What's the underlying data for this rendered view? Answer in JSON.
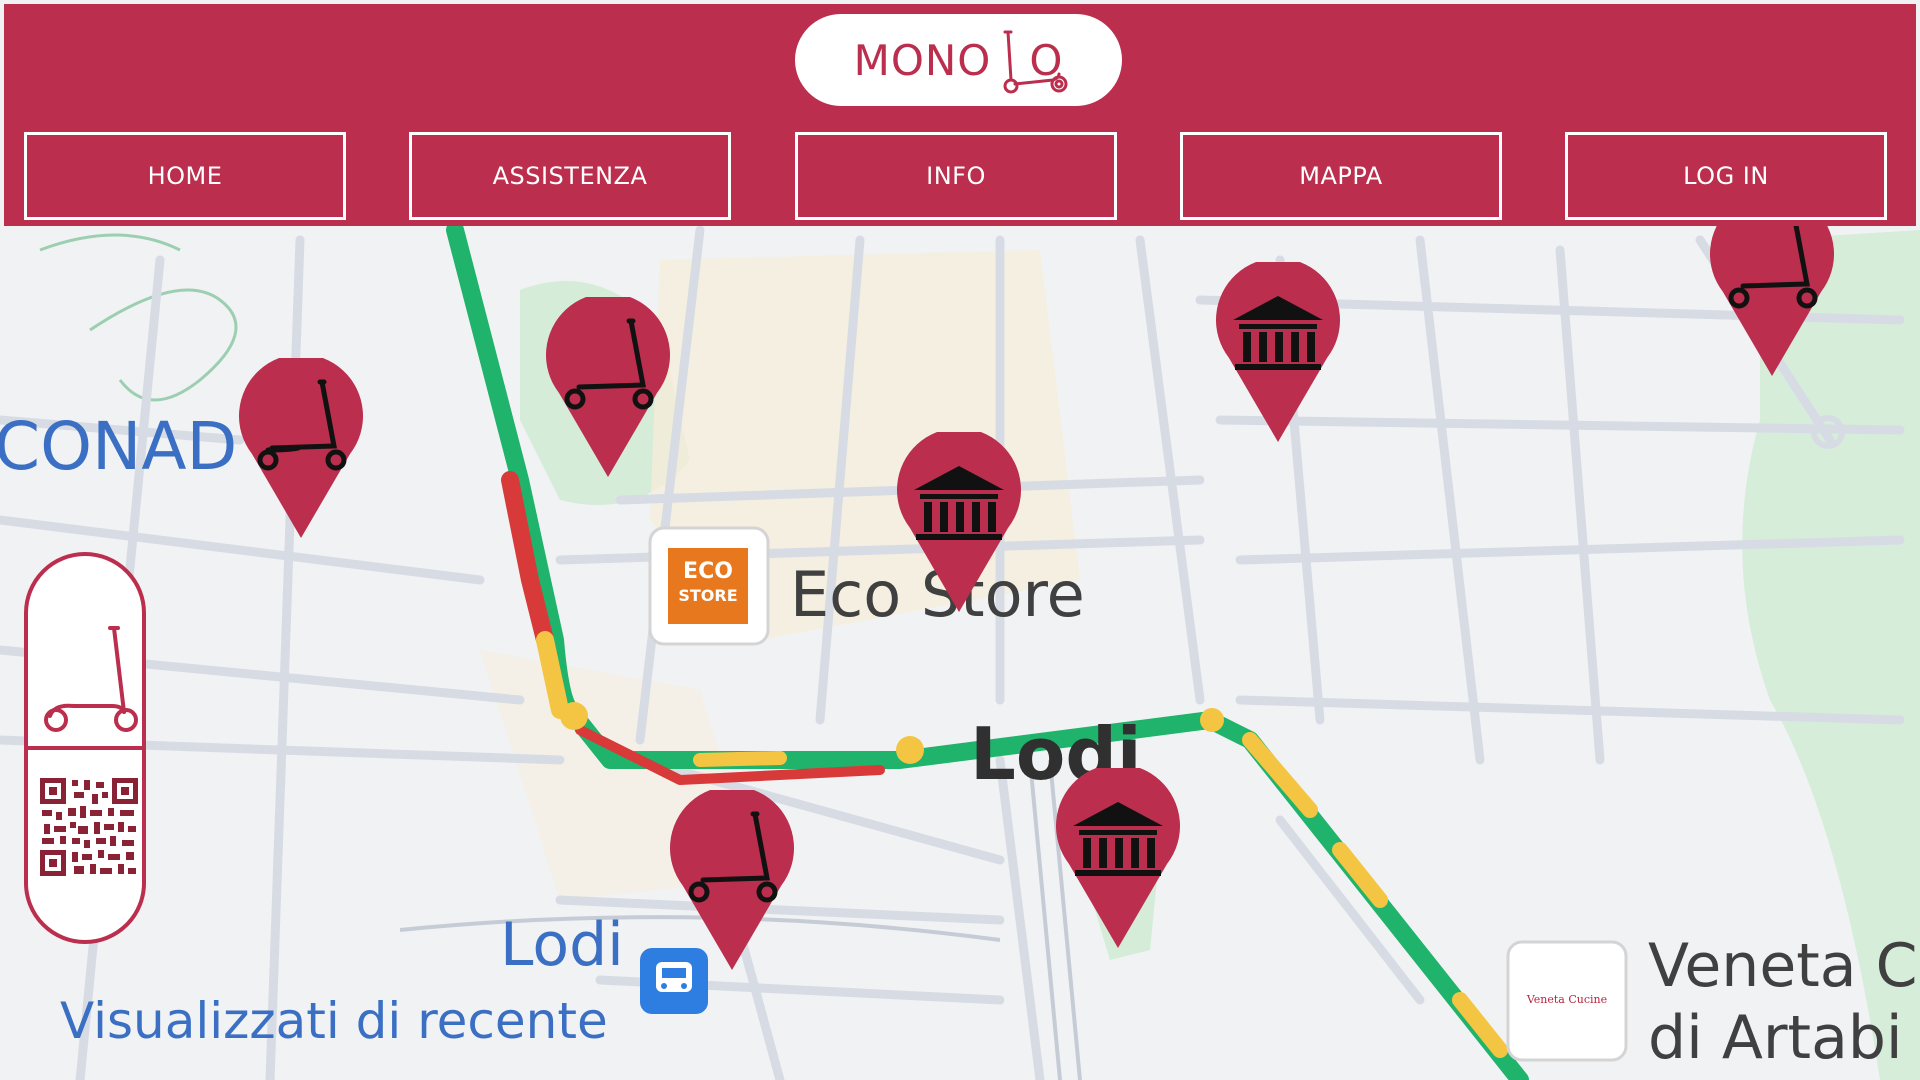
{
  "brand": {
    "logo_text_left": "MONO",
    "logo_text_right": "O"
  },
  "nav": [
    "HOME",
    "ASSISTENZA",
    "INFO",
    "MAPPA",
    "LOG IN"
  ],
  "map": {
    "labels": {
      "conad": "CONAD",
      "eco_store": "Eco Store",
      "eco_logo_line1": "ECO",
      "eco_logo_line2": "STORE",
      "lodi_center": "Lodi",
      "lodi_station": "Lodi",
      "recent": "Visualizzati di recente",
      "veneta_line1": "Veneta C",
      "veneta_line2": "di Artabi",
      "veneta_logo": "Veneta Cucine"
    },
    "pins": [
      "scooter-pin",
      "scooter-pin",
      "museum-pin",
      "museum-pin",
      "scooter-pin",
      "scooter-pin",
      "museum-pin"
    ]
  },
  "colors": {
    "brand": "#bb2e4d",
    "traffic_green": "#1fb36b",
    "traffic_yellow": "#f4c542",
    "traffic_red": "#d83a3a",
    "label_blue": "#3a6fc4"
  }
}
